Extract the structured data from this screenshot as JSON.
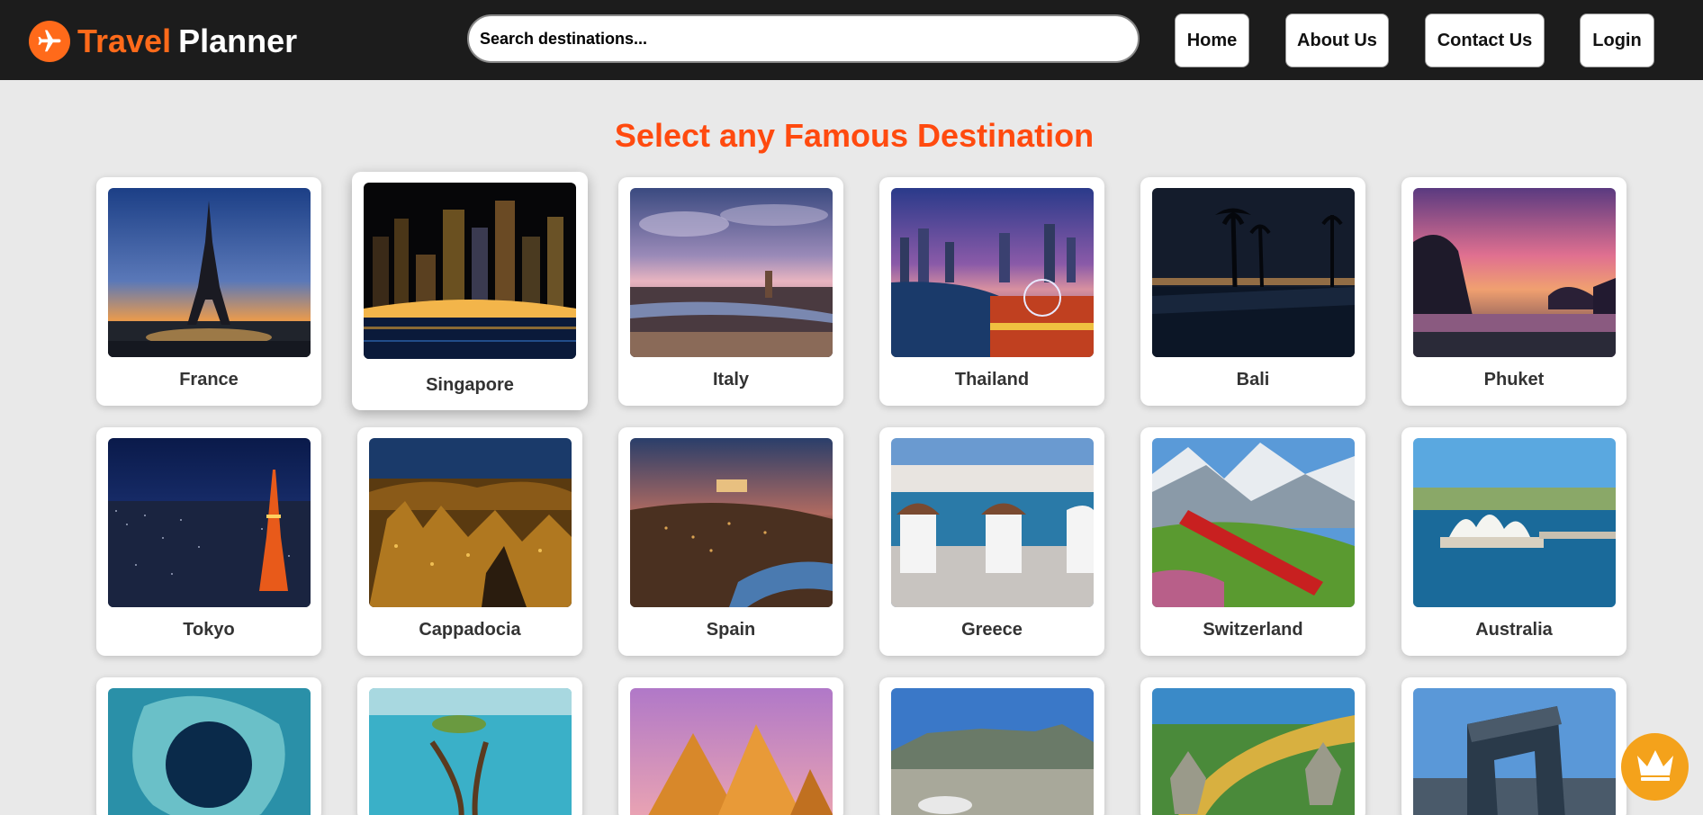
{
  "brand": {
    "word1": "Travel",
    "word2": "Planner"
  },
  "search": {
    "placeholder": "Search destinations..."
  },
  "nav": {
    "home": "Home",
    "about": "About Us",
    "contact": "Contact Us",
    "login": "Login"
  },
  "heading": "Select any Famous Destination",
  "destinations": [
    {
      "name": "France"
    },
    {
      "name": "Singapore"
    },
    {
      "name": "Italy"
    },
    {
      "name": "Thailand"
    },
    {
      "name": "Bali"
    },
    {
      "name": "Phuket"
    },
    {
      "name": "Tokyo"
    },
    {
      "name": "Cappadocia"
    },
    {
      "name": "Spain"
    },
    {
      "name": "Greece"
    },
    {
      "name": "Switzerland"
    },
    {
      "name": "Australia"
    }
  ],
  "colors": {
    "accent": "#ff4a0f",
    "navbar": "#1c1c1c",
    "background": "#e9e9e9",
    "premium": "#f4a21b"
  },
  "icons": {
    "logo": "airplane-icon",
    "premium": "crown-icon"
  }
}
